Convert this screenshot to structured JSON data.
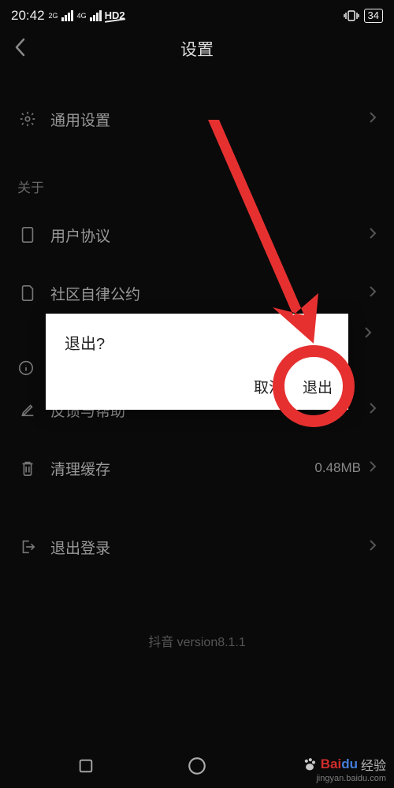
{
  "status": {
    "time": "20:42",
    "net2g": "2G",
    "net4g": "4G",
    "hd2": "HD2",
    "battery": "34"
  },
  "header": {
    "title": "设置"
  },
  "rows": {
    "general": "通用设置",
    "about_section": "关于",
    "agreement": "用户协议",
    "community": "社区自律公约",
    "feedback": "反馈与帮助",
    "cache": "清理缓存",
    "cache_value": "0.48MB",
    "logout": "退出登录"
  },
  "version": "抖音 version8.1.1",
  "dialog": {
    "title": "退出?",
    "cancel": "取消",
    "confirm": "退出"
  },
  "watermark": {
    "brand_b": "Bai",
    "brand_du": "du",
    "sub": "经验",
    "url": "jingyan.baidu.com"
  }
}
